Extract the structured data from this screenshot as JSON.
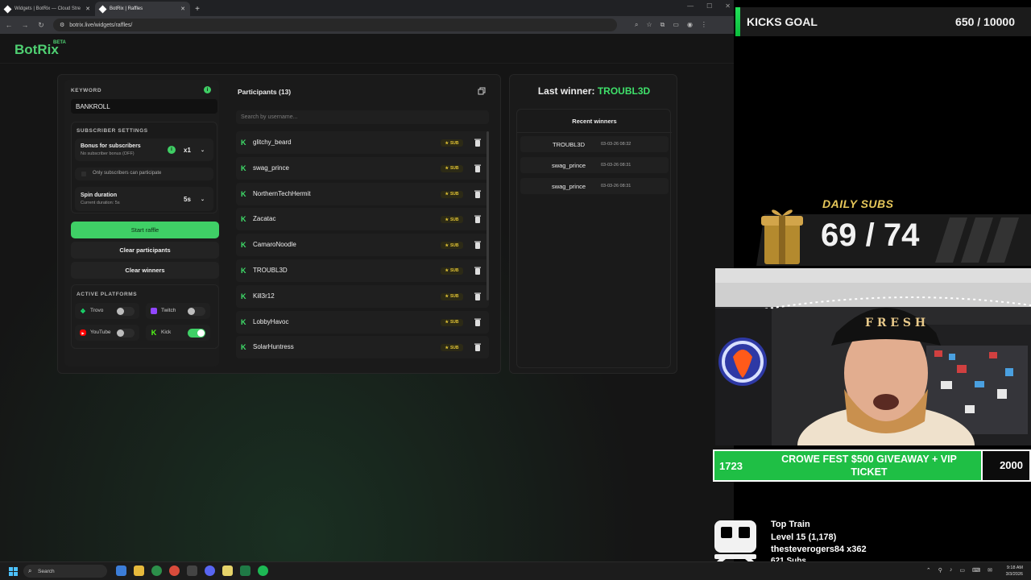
{
  "browser": {
    "tabs": [
      {
        "title": "Widgets | BotRix — Cloud Stre",
        "active": false
      },
      {
        "title": "BotRix | Raffles",
        "active": true
      }
    ],
    "url": "botrix.live/widgets/raffles/"
  },
  "app": {
    "logo": "BotRix",
    "badge": "BETA"
  },
  "settings": {
    "keyword_label": "KEYWORD",
    "keyword_value": "BANKROLL",
    "subscriber_settings_label": "SUBSCRIBER SETTINGS",
    "bonus_title": "Bonus for subscribers",
    "bonus_subtitle": "No subscriber bonus (OFF)",
    "bonus_value": "x1",
    "only_subs_label": "Only subscribers can participate",
    "spin_title": "Spin duration",
    "spin_subtitle": "Current duration: 5s",
    "spin_value": "5s",
    "start_button": "Start raffle",
    "clear_participants_button": "Clear participants",
    "clear_winners_button": "Clear winners",
    "platforms_label": "ACTIVE PLATFORMS",
    "platforms": [
      {
        "name": "Trovo",
        "enabled": false,
        "color": "#19d66b"
      },
      {
        "name": "Twitch",
        "enabled": false,
        "color": "#9146ff"
      },
      {
        "name": "YouTube",
        "enabled": false,
        "color": "#ff0000"
      },
      {
        "name": "Kick",
        "enabled": true,
        "color": "#53fc18"
      }
    ]
  },
  "participants": {
    "title": "Participants (13)",
    "search_placeholder": "Search by username...",
    "sub_badge": "SUB",
    "list": [
      "glitchy_beard",
      "swag_prince",
      "NorthernTechHermit",
      "Zacatac",
      "CamaroNoodle",
      "TROUBL3D",
      "Kill3r12",
      "LobbyHavoc",
      "SolarHuntress"
    ]
  },
  "winners": {
    "last_winner_label": "Last winner:",
    "last_winner_name": "TROUBL3D",
    "recent_title": "Recent winners",
    "recent": [
      {
        "name": "TROUBL3D",
        "date": "03-03-26 08:32"
      },
      {
        "name": "swag_prince",
        "date": "03-03-26 08:31"
      },
      {
        "name": "swag_prince",
        "date": "03-03-26 08:31"
      }
    ]
  },
  "taskbar": {
    "search_label": "Search",
    "time": "9:18 AM",
    "date": "3/3/2026"
  },
  "overlay": {
    "kicks_goal_label": "KICKS GOAL",
    "kicks_goal_value": "650 / 10000",
    "daily_subs_label": "DAILY SUBS",
    "daily_subs_value": "69 / 74",
    "goal_start": "1723",
    "goal_title": "CROWE FEST $500 GIVEAWAY + VIP TICKET",
    "goal_end": "2000",
    "train_title": "Top Train",
    "train_level": "Level 15  (1,178)",
    "train_user": "thesteverogers84 x362",
    "train_subs": "621 Subs"
  },
  "colors": {
    "accent": "#3fcf66",
    "kick_green": "#3fe06a",
    "gold": "#e6c75a"
  }
}
